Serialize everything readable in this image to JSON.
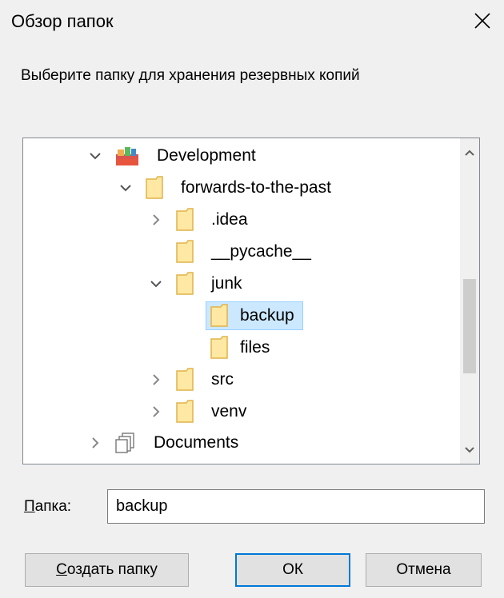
{
  "dialog": {
    "title": "Обзор папок",
    "prompt": "Выберите папку для хранения резервных копий"
  },
  "tree": {
    "items": [
      {
        "label": "Development",
        "icon": "library-color-icon",
        "expander": "expanded"
      },
      {
        "label": "forwards-to-the-past",
        "icon": "folder-icon",
        "expander": "expanded"
      },
      {
        "label": ".idea",
        "icon": "folder-icon",
        "expander": "collapsed"
      },
      {
        "label": "__pycache__",
        "icon": "folder-icon",
        "expander": "none"
      },
      {
        "label": "junk",
        "icon": "folder-icon",
        "expander": "expanded"
      },
      {
        "label": "backup",
        "icon": "folder-icon",
        "expander": "none",
        "selected": true
      },
      {
        "label": "files",
        "icon": "folder-icon",
        "expander": "none"
      },
      {
        "label": "src",
        "icon": "folder-icon",
        "expander": "collapsed"
      },
      {
        "label": "venv",
        "icon": "folder-icon",
        "expander": "collapsed"
      },
      {
        "label": "Documents",
        "icon": "documents-library-icon",
        "expander": "collapsed"
      }
    ]
  },
  "folder_field": {
    "label_underlined": "П",
    "label_rest": "апка:",
    "value": "backup"
  },
  "buttons": {
    "create_underlined": "С",
    "create_rest": "оздать папку",
    "ok": "ОК",
    "cancel": "Отмена"
  },
  "colors": {
    "selection_bg": "#cce8ff",
    "selection_border": "#99d1ff",
    "default_button_border": "#0078d7",
    "folder_fill": "#ffe8a3",
    "folder_stroke": "#e0b34a"
  }
}
